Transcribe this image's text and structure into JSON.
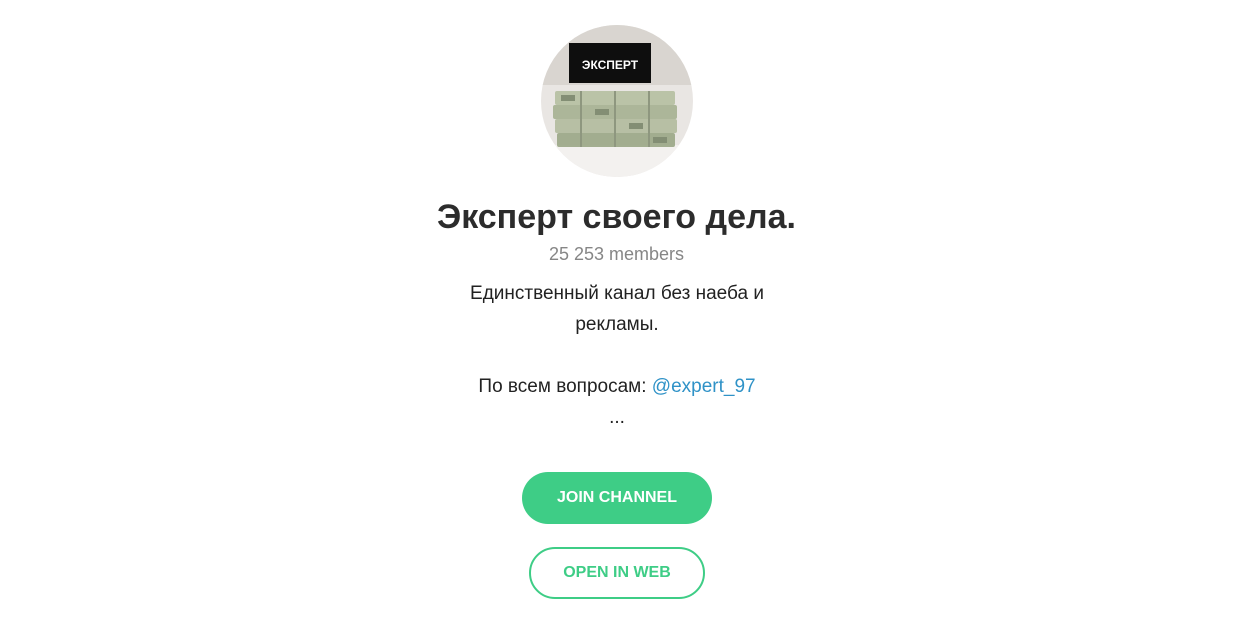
{
  "channel": {
    "avatar_text": "ЭКСПЕРТ",
    "title": "Эксперт своего дела.",
    "members": "25 253 members",
    "description": {
      "line1": "Единственный канал без наеба и",
      "line2": "рекламы.",
      "contact_prefix": "По всем вопросам: ",
      "contact_link": "@expert_97",
      "ellipsis": "..."
    }
  },
  "actions": {
    "join_label": "JOIN CHANNEL",
    "web_label": "OPEN IN WEB"
  },
  "colors": {
    "accent": "#3ecd86",
    "link": "#2f92c7",
    "title": "#2c2c2c",
    "muted": "#868686"
  }
}
